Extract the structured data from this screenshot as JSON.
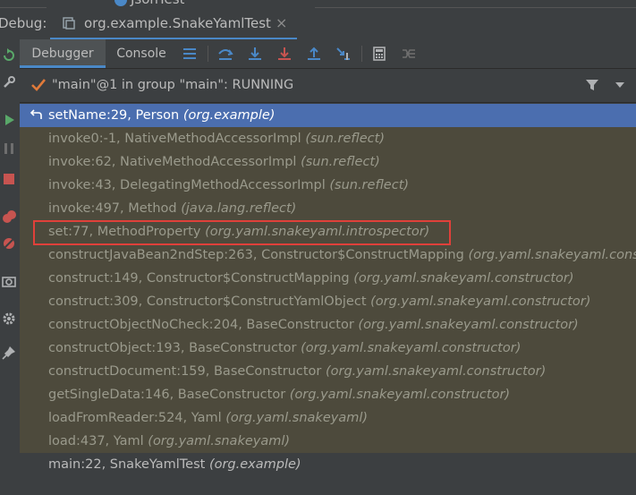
{
  "window": {
    "debug_label": "Debug:",
    "prev_tab_partial": "JsonTest",
    "run_tab_title": "org.example.SnakeYamlTest",
    "close_glyph": "×"
  },
  "toolbar": {
    "tabs": [
      {
        "label": "Debugger",
        "active": true
      },
      {
        "label": "Console",
        "active": false
      }
    ],
    "icons": [
      "layout-icon",
      "show-execution-point-icon",
      "step-over-icon",
      "step-into-icon",
      "force-step-into-icon",
      "step-out-icon",
      "run-to-cursor-icon",
      "evaluate-expression-icon",
      "trace-current-stream-icon"
    ]
  },
  "thread": {
    "label": "\"main\"@1 in group \"main\": RUNNING",
    "status_color": "#e07a3a"
  },
  "gutter": {
    "icons": [
      "rerun-icon",
      "modify-settings-icon",
      "resume-icon",
      "pause-icon",
      "stop-icon",
      "view-breakpoints-icon",
      "mute-breakpoints-icon",
      "camera-icon",
      "settings-icon",
      "pin-icon"
    ]
  },
  "frames": [
    {
      "method": "setName:29, Person ",
      "pkg": "(org.example)",
      "kind": "selected"
    },
    {
      "method": "invoke0:-1, NativeMethodAccessorImpl ",
      "pkg": "(sun.reflect)",
      "kind": "library"
    },
    {
      "method": "invoke:62, NativeMethodAccessorImpl ",
      "pkg": "(sun.reflect)",
      "kind": "library"
    },
    {
      "method": "invoke:43, DelegatingMethodAccessorImpl ",
      "pkg": "(sun.reflect)",
      "kind": "library"
    },
    {
      "method": "invoke:497, Method ",
      "pkg": "(java.lang.reflect)",
      "kind": "library"
    },
    {
      "method": "set:77, MethodProperty ",
      "pkg": "(org.yaml.snakeyaml.introspector)",
      "kind": "library"
    },
    {
      "method": "constructJavaBean2ndStep:263, Constructor$ConstructMapping ",
      "pkg": "(org.yaml.snakeyaml.cons",
      "kind": "library"
    },
    {
      "method": "construct:149, Constructor$ConstructMapping ",
      "pkg": "(org.yaml.snakeyaml.constructor)",
      "kind": "library"
    },
    {
      "method": "construct:309, Constructor$ConstructYamlObject ",
      "pkg": "(org.yaml.snakeyaml.constructor)",
      "kind": "library"
    },
    {
      "method": "constructObjectNoCheck:204, BaseConstructor ",
      "pkg": "(org.yaml.snakeyaml.constructor)",
      "kind": "library"
    },
    {
      "method": "constructObject:193, BaseConstructor ",
      "pkg": "(org.yaml.snakeyaml.constructor)",
      "kind": "library"
    },
    {
      "method": "constructDocument:159, BaseConstructor ",
      "pkg": "(org.yaml.snakeyaml.constructor)",
      "kind": "library"
    },
    {
      "method": "getSingleData:146, BaseConstructor ",
      "pkg": "(org.yaml.snakeyaml.constructor)",
      "kind": "library"
    },
    {
      "method": "loadFromReader:524, Yaml ",
      "pkg": "(org.yaml.snakeyaml)",
      "kind": "library"
    },
    {
      "method": "load:437, Yaml ",
      "pkg": "(org.yaml.snakeyaml)",
      "kind": "library"
    },
    {
      "method": "main:22, SnakeYamlTest ",
      "pkg": "(org.example)",
      "kind": "normal"
    }
  ],
  "annotation": {
    "highlighted_frame_index": 5,
    "color": "#e0403a"
  }
}
